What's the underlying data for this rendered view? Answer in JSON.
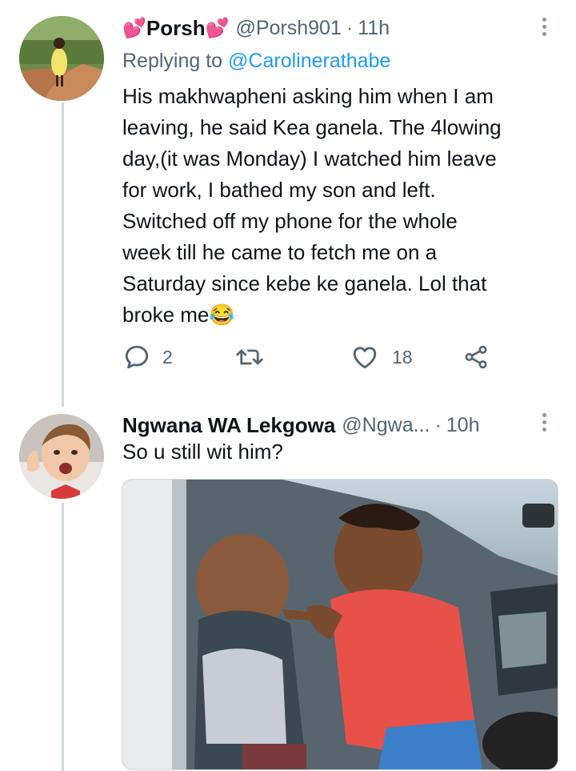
{
  "tweet1": {
    "display_name": "Porsh",
    "name_emoji": "💕",
    "handle": "@Porsh901",
    "separator": "·",
    "time": "11h",
    "replying_prefix": "Replying to ",
    "replying_to": "@Carolinerathabe",
    "text": "His makhwapheni asking him when I am\nleaving, he said Kea ganela. The 4lowing\nday,(it was Monday) I watched him leave\nfor work, I bathed my son and left.\nSwitched off my phone for the whole\nweek till he came to fetch me on a\nSaturday since kebe ke ganela. Lol that\nbroke me😂",
    "actions": {
      "reply_count": "2",
      "retweet_count": "",
      "like_count": "18"
    }
  },
  "tweet2": {
    "display_name": "Ngwana WA Lekgowa",
    "handle": "@Ngwa...",
    "separator": "·",
    "time": "10h",
    "text": "So u still wit him?"
  },
  "icons": {
    "more": "more-vertical-icon",
    "reply": "reply-bubble-icon",
    "retweet": "retweet-icon",
    "like": "heart-icon",
    "share": "share-icon"
  },
  "colors": {
    "link": "#1d9bf0",
    "secondary_text": "#536471",
    "thread_line": "#cfd9de",
    "heart_emoji": "#d21f3c"
  }
}
